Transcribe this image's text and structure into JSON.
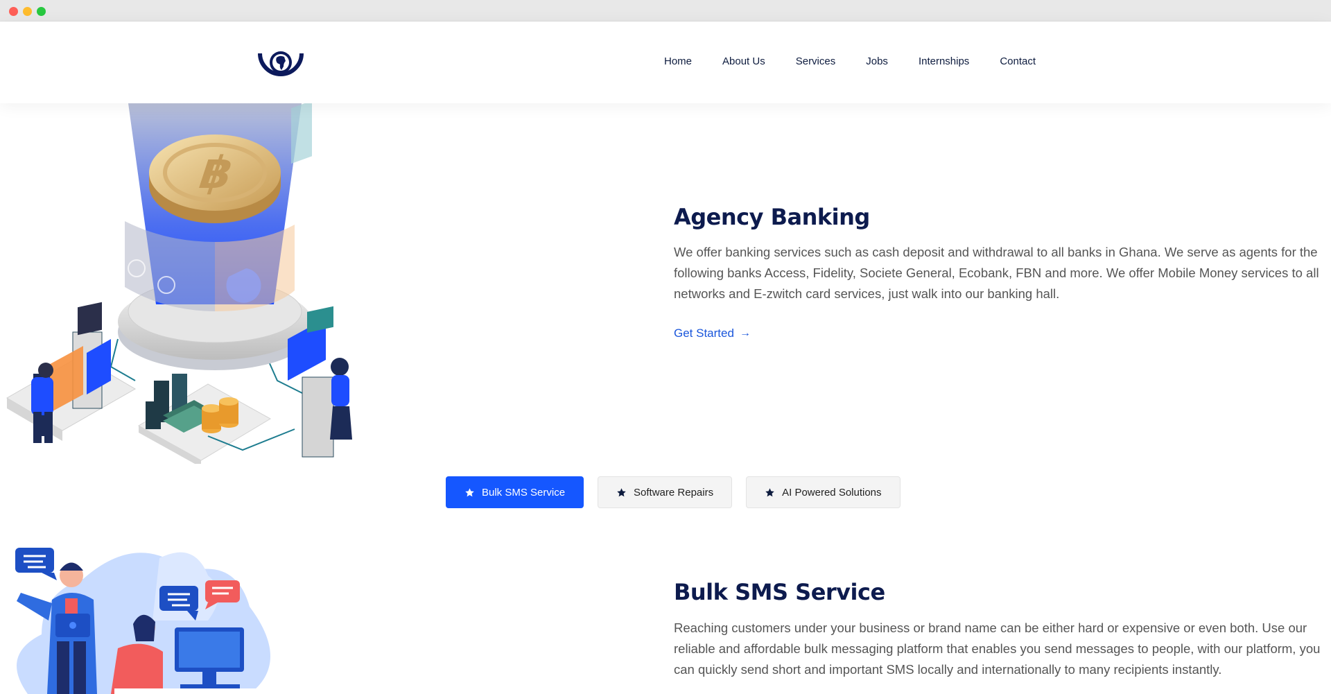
{
  "nav": {
    "items": [
      "Home",
      "About Us",
      "Services",
      "Jobs",
      "Internships",
      "Contact"
    ]
  },
  "agency": {
    "title": "Agency Banking",
    "text": "We offer banking services such as cash deposit and withdrawal to all banks in Ghana. We serve as agents for the following banks Access, Fidelity, Societe General, Ecobank, FBN and more. We offer Mobile Money services to all networks and  E-zwitch card services, just walk into our banking hall.",
    "cta": "Get Started",
    "cta_icon": "arrow-right-icon"
  },
  "tabs": [
    {
      "label": "Bulk SMS Service",
      "icon": "star-icon",
      "active": true
    },
    {
      "label": "Software Repairs",
      "icon": "star-icon",
      "active": false
    },
    {
      "label": "AI Powered Solutions",
      "icon": "star-icon",
      "active": false
    }
  ],
  "bulk": {
    "title": "Bulk SMS Service",
    "text": "Reaching customers under your business or brand name can be either hard or expensive or even both. Use our reliable and affordable  bulk messaging platform that enables you send messages to people, with our platform, you can quickly send short and important SMS locally and internationally to many recipients instantly."
  },
  "colors": {
    "primary": "#1557ff",
    "heading": "#0d1b4e",
    "link": "#1a56db"
  }
}
